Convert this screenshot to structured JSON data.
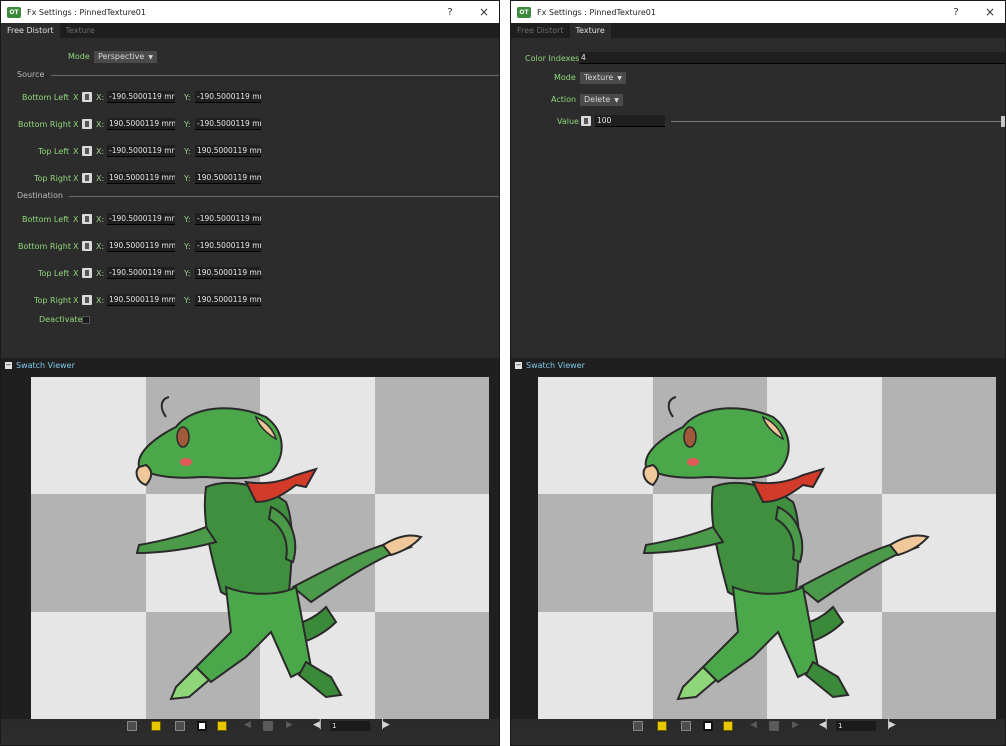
{
  "left": {
    "title": "Fx Settings : PinnedTexture01",
    "help": "?",
    "close": "×",
    "tabs": [
      "Free Distort",
      "Texture"
    ],
    "mode_label": "Mode",
    "mode_value": "Perspective",
    "source_label": "Source",
    "destination_label": "Destination",
    "rows_labels": [
      "Bottom Left",
      "Bottom Right",
      "Top Left",
      "Top Right"
    ],
    "x_axis": "X:",
    "y_axis": "Y:",
    "x_marker": "X",
    "source_values": [
      {
        "x": "-190.5000119 mr",
        "y": "-190.5000119 mr"
      },
      {
        "x": "190.5000119 mm",
        "y": "-190.5000119 mr"
      },
      {
        "x": "-190.5000119 mr",
        "y": "190.5000119 mm"
      },
      {
        "x": "190.5000119 mm",
        "y": "190.5000119 mm"
      }
    ],
    "dest_values": [
      {
        "x": "-190.5000119 mr",
        "y": "-190.5000119 mr"
      },
      {
        "x": "190.5000119 mm",
        "y": "-190.5000119 mr"
      },
      {
        "x": "-190.5000119 mr",
        "y": "190.5000119 mm"
      },
      {
        "x": "190.5000119 mm",
        "y": "190.5000119 mm"
      }
    ],
    "deactivate_label": "Deactivate",
    "swatch_title": "Swatch Viewer",
    "frame_value": "1"
  },
  "right": {
    "title": "Fx Settings : PinnedTexture01",
    "help": "?",
    "close": "×",
    "tabs": [
      "Free Distort",
      "Texture"
    ],
    "color_indexes_label": "Color Indexes",
    "color_indexes_value": "4",
    "mode_label": "Mode",
    "mode_value": "Texture",
    "action_label": "Action",
    "action_value": "Delete",
    "value_label": "Value",
    "value_value": "100",
    "swatch_title": "Swatch Viewer",
    "frame_value": "1"
  },
  "colors": {
    "label_green": "#8fd67a",
    "panel_bg": "#2c2c2c",
    "accent_yellow": "#e6c700",
    "swatch_blue": "#7fc8e8",
    "character_green": "#4aa84a"
  },
  "icons": [
    "app-icon",
    "help-icon",
    "close-icon",
    "collapse-icon",
    "link-icon",
    "slider-handle-icon",
    "checkerboard-icon",
    "camera-icon",
    "prev-frame-icon",
    "next-frame-icon"
  ]
}
